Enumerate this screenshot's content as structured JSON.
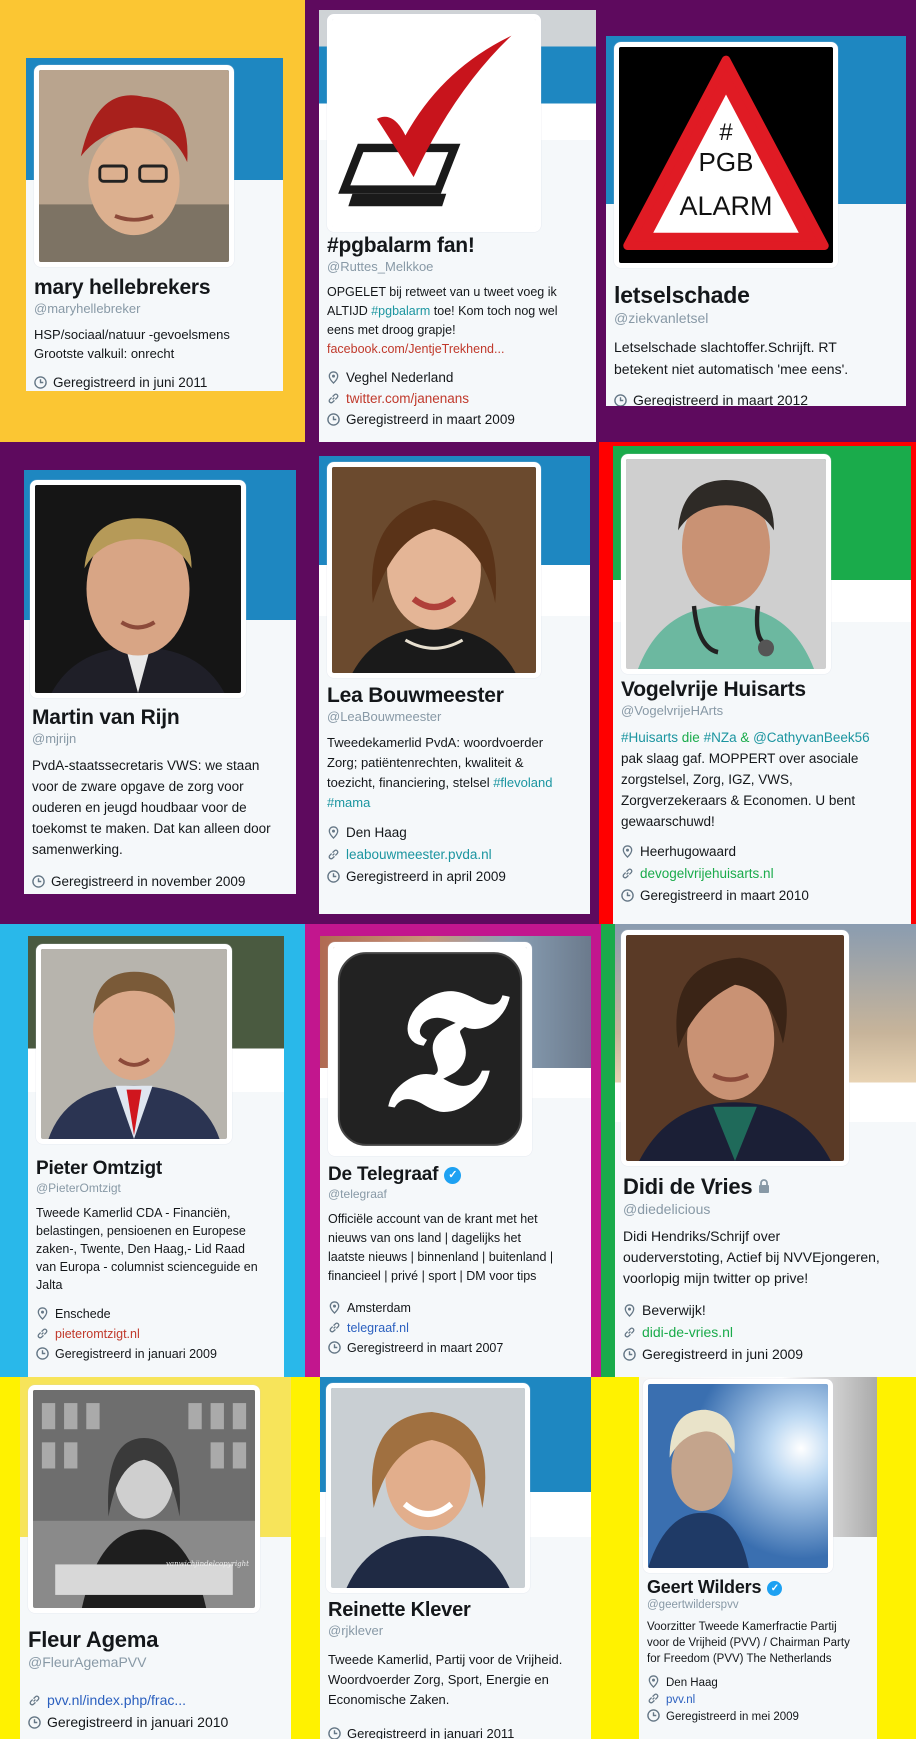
{
  "cards": [
    {
      "name": "mary hellebrekers",
      "handle": "@maryhellebreker",
      "bio": [
        "HSP/sociaal/natuur -gevoelsmens",
        "Grootste valkuil: onrecht"
      ],
      "location": "",
      "link": "",
      "joined": "Geregistreerd in juni 2011",
      "cell_color": "#fbc633"
    },
    {
      "name": "#pgbalarm fan!",
      "handle": "@Ruttes_Melkkoe",
      "bio": [
        "OPGELET bij retweet van u tweet voeg ik",
        "ALTIJD #pgbalarm toe! Kom toch nog wel",
        "eens met droog grapje!",
        "facebook.com/JentjeTrekhend..."
      ],
      "location": "Veghel Nederland",
      "link": "twitter.com/janenans",
      "joined": "Geregistreerd in maart 2009",
      "cell_color": "#5e0a5e"
    },
    {
      "name": "letselschade",
      "handle": "@ziekvanletsel",
      "bio": [
        "Letselschade slachtoffer.Schrijft. RT",
        "betekent niet automatisch 'mee eens'."
      ],
      "location": "",
      "link": "",
      "joined": "Geregistreerd in maart 2012",
      "cell_color": "#5e0a5e",
      "avatar_text": [
        "#",
        "PGB",
        "ALARM"
      ]
    },
    {
      "name": "Martin van Rijn",
      "handle": "@mjrijn",
      "bio": [
        "PvdA-staatssecretaris VWS: we staan",
        "voor de zware opgave de zorg voor",
        "ouderen en jeugd houdbaar voor de",
        "toekomst te maken. Dat kan alleen door",
        "samenwerking."
      ],
      "location": "",
      "link": "",
      "joined": "Geregistreerd in november 2009",
      "cell_color": "#5e0a5e"
    },
    {
      "name": "Lea Bouwmeester",
      "handle": "@LeaBouwmeester",
      "bio": [
        "Tweedekamerlid PvdA: woordvoerder",
        "Zorg; patiëntenrechten, kwaliteit &",
        "toezicht, financiering, stelsel #flevoland",
        "#mama"
      ],
      "location": "Den Haag",
      "link": "leabouwmeester.pvda.nl",
      "joined": "Geregistreerd in april 2009",
      "cell_color": "#5e0a5e"
    },
    {
      "name": "Vogelvrije Huisarts",
      "handle": "@VogelvrijeHArts",
      "bio": [
        "#Huisarts die #NZa & @CathyvanBeek56",
        "pak slaag gaf. MOPPERT over asociale",
        "zorgstelsel, Zorg, IGZ, VWS,",
        "Zorgverzekeraars & Economen. U bent",
        "gewaarschuwd!"
      ],
      "location": "Heerhugowaard",
      "link": "devogelvrijehuisarts.nl",
      "joined": "Geregistreerd in maart 2010",
      "cell_color": "#ff0000"
    },
    {
      "name": "Pieter Omtzigt",
      "handle": "@PieterOmtzigt",
      "bio": [
        "Tweede Kamerlid CDA - Financiën,",
        "belastingen, pensioenen en Europese",
        "zaken-, Twente, Den Haag,- Lid Raad",
        "van Europa - columnist scienceguide en",
        "Jalta"
      ],
      "location": "Enschede",
      "link": "pieteromtzigt.nl",
      "joined": "Geregistreerd in januari 2009",
      "cell_color": "#29b8ea"
    },
    {
      "name": "De Telegraaf",
      "handle": "@telegraaf",
      "bio": [
        "Officiële account van de krant met het",
        "nieuws van ons land | dagelijks het",
        "laatste nieuws | binnenland | buitenland |",
        "financieel | privé | sport | DM voor tips"
      ],
      "location": "Amsterdam",
      "link": "telegraaf.nl",
      "joined": "Geregistreerd in maart 2007",
      "cell_color": "#c2168e"
    },
    {
      "name": "Didi de Vries",
      "handle": "@diedelicious",
      "bio": [
        "Didi Hendriks/Schrijf over",
        "ouderverstoting, Actief bij NVVEjongeren,",
        "voorlopig mijn twitter op prive!"
      ],
      "location": "Beverwijk!",
      "link": "didi-de-vries.nl",
      "joined": "Geregistreerd in juni 2009",
      "cell_color": "#1aab4b"
    },
    {
      "name": "Fleur Agema",
      "handle": "@FleurAgemaPVV",
      "bio": [],
      "location": "",
      "link": "pvv.nl/index.php/frac...",
      "joined": "Geregistreerd in januari 2010",
      "cell_color": "#fff200",
      "avatar_text": "vanwichjindelcopyright"
    },
    {
      "name": "Reinette Klever",
      "handle": "@rjklever",
      "bio": [
        "Tweede Kamerlid, Partij voor de Vrijheid.",
        "Woordvoerder Zorg, Sport, Energie en",
        "Economische Zaken."
      ],
      "location": "",
      "link": "",
      "joined": "Geregistreerd in januari 2011",
      "cell_color": "#fff200"
    },
    {
      "name": "Geert Wilders",
      "handle": "@geertwilderspvv",
      "bio": [
        "Voorzitter Tweede Kamerfractie Partij",
        "voor de Vrijheid (PVV) / Chairman Party",
        "for Freedom (PVV) The Netherlands"
      ],
      "location": "Den Haag",
      "link": "pvv.nl",
      "joined": "Geregistreerd in mei 2009",
      "cell_color": "#fff200"
    }
  ]
}
